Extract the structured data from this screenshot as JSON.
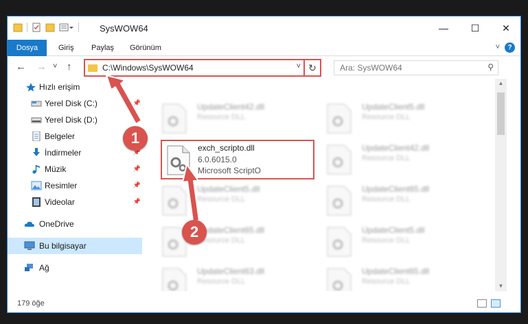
{
  "window": {
    "title": "SysWOW64",
    "minimize": "—",
    "maximize": "☐",
    "close": "✕"
  },
  "ribbon": {
    "tabs": [
      "Dosya",
      "Giriş",
      "Paylaş",
      "Görünüm"
    ],
    "help": "?"
  },
  "nav": {
    "back": "←",
    "forward": "→",
    "dropdown": "˅",
    "up": "↑",
    "address": "C:\\Windows\\SysWOW64",
    "refresh": "↻",
    "search_placeholder": "Ara: SysWOW64"
  },
  "sidebar": {
    "items": [
      {
        "label": "Hızlı erişim",
        "icon": "star-icon",
        "pinned": false
      },
      {
        "label": "Yerel Disk (C:)",
        "icon": "drive-icon",
        "pinned": true
      },
      {
        "label": "Yerel Disk (D:)",
        "icon": "drive-icon",
        "pinned": true
      },
      {
        "label": "Belgeler",
        "icon": "documents-icon",
        "pinned": true
      },
      {
        "label": "İndirmeler",
        "icon": "downloads-icon",
        "pinned": true
      },
      {
        "label": "Müzik",
        "icon": "music-icon",
        "pinned": true
      },
      {
        "label": "Resimler",
        "icon": "pictures-icon",
        "pinned": true
      },
      {
        "label": "Videolar",
        "icon": "videos-icon",
        "pinned": true
      },
      {
        "label": "OneDrive",
        "icon": "cloud-icon",
        "pinned": false
      },
      {
        "label": "Bu bilgisayar",
        "icon": "computer-icon",
        "pinned": false,
        "selected": true
      },
      {
        "label": "Ağ",
        "icon": "network-icon",
        "pinned": false
      }
    ]
  },
  "files": {
    "highlighted": {
      "name": "exch_scripto.dll",
      "version": "6.0.6015.0",
      "description": "Microsoft ScriptO"
    },
    "left_column": [
      {
        "name": "UpdateClient42.dll",
        "type": "Resource DLL"
      },
      {
        "name": "UpdateClient5.dll",
        "type": "Resource DLL"
      },
      {
        "name": "UpdateClient65.dll",
        "type": "Resource DLL"
      },
      {
        "name": "UpdateClient63.dll",
        "type": "Resource DLL"
      }
    ],
    "right_column": [
      {
        "name": "UpdateClient5.dll",
        "type": "Resource DLL"
      },
      {
        "name": "UpdateClient42.dll",
        "type": "Resource DLL"
      },
      {
        "name": "UpdateClient65.dll",
        "type": "Resource DLL"
      },
      {
        "name": "UpdateClient5.dll",
        "type": "Resource DLL"
      },
      {
        "name": "UpdateClient65.dll",
        "type": "Resource DLL"
      }
    ]
  },
  "status": {
    "item_count": "179 öğe"
  },
  "annotations": {
    "step1": "1",
    "step2": "2",
    "color": "#d9534f"
  }
}
